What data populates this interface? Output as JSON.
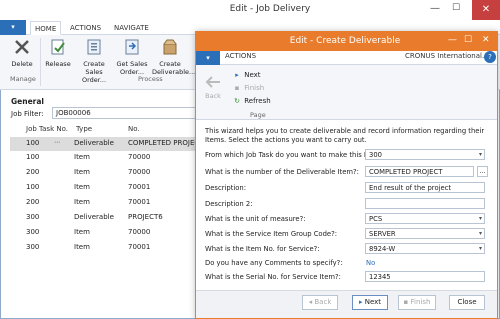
{
  "back_window": {
    "title": "Edit - Job Delivery",
    "app_button": "▾",
    "tabs": [
      "HOME",
      "ACTIONS",
      "NAVIGATE"
    ],
    "ribbon": {
      "buttons": [
        "Delete",
        "Release",
        "Create Sales Order...",
        "Get Sales Order...",
        "Create Deliverable..."
      ],
      "groups": [
        "Manage",
        "Process"
      ]
    },
    "general_heading": "General",
    "job_filter_label": "Job Filter:",
    "job_filter_value": "JOB00006",
    "grid": {
      "headers": [
        "Job Task No.",
        "Type",
        "No."
      ],
      "rows": [
        {
          "task": "100",
          "type": "Deliverable",
          "no": "COMPLETED PROJECT"
        },
        {
          "task": "100",
          "type": "Item",
          "no": "70000"
        },
        {
          "task": "200",
          "type": "Item",
          "no": "70000"
        },
        {
          "task": "100",
          "type": "Item",
          "no": "70001"
        },
        {
          "task": "200",
          "type": "Item",
          "no": "70001"
        },
        {
          "task": "300",
          "type": "Deliverable",
          "no": "PROJECT6"
        },
        {
          "task": "300",
          "type": "Item",
          "no": "70000"
        },
        {
          "task": "300",
          "type": "Item",
          "no": "70001"
        }
      ]
    }
  },
  "dialog": {
    "title": "Edit - Create Deliverable",
    "app_button": "▾",
    "tab": "ACTIONS",
    "company": "CRONUS International...",
    "help": "?",
    "ribbon": {
      "back": "Back",
      "next": "Next",
      "finish": "Finish",
      "refresh": "Refresh",
      "group": "Page"
    },
    "intro": "This wizard helps you to create deliverable and record information regarding their Items. Select the actions you want to carry out.",
    "fields": [
      {
        "label": "From which Job Task do you want to make this Delivery?:",
        "value": "300",
        "kind": "dropdown"
      },
      {
        "label": "What is the number of the Deliverable Item?:",
        "value": "COMPLETED PROJECT",
        "kind": "assist"
      },
      {
        "label": "Description:",
        "value": "End result of the project",
        "kind": "text"
      },
      {
        "label": "Description 2:",
        "value": "",
        "kind": "text"
      },
      {
        "label": "What is the unit of measure?:",
        "value": "PCS",
        "kind": "dropdown"
      },
      {
        "label": "What is the Service Item Group Code?:",
        "value": "SERVER",
        "kind": "dropdown"
      },
      {
        "label": "What is the Item No. for Service?:",
        "value": "8924-W",
        "kind": "dropdown"
      },
      {
        "label": "Do you have any Comments to specify?:",
        "value": "No",
        "kind": "link"
      },
      {
        "label": "What is the Serial No. for Service Item?:",
        "value": "12345",
        "kind": "text"
      }
    ],
    "buttons": {
      "back": "Back",
      "next": "Next",
      "finish": "Finish",
      "close": "Close"
    }
  }
}
